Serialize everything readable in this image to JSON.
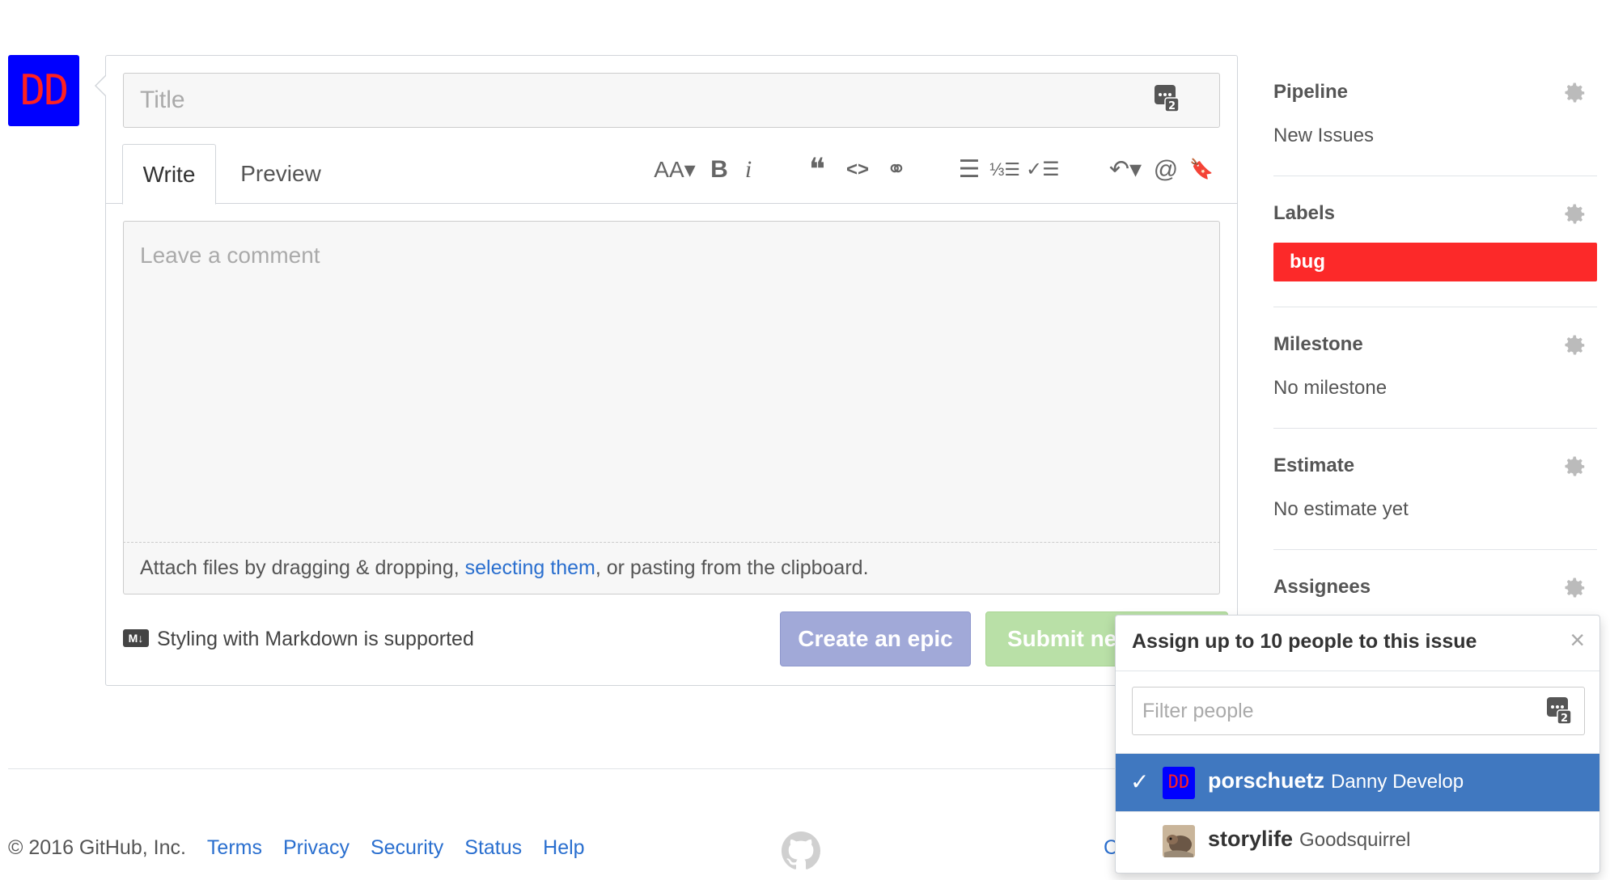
{
  "author_avatar": {
    "initials": "DD",
    "bg": "#0000ff",
    "fg": "#ff2020"
  },
  "editor": {
    "title_placeholder": "Title",
    "tabs": [
      {
        "label": "Write",
        "active": true
      },
      {
        "label": "Preview",
        "active": false
      }
    ],
    "toolbar": {
      "heading": "AA▾",
      "bold": "B",
      "italic": "i",
      "quote": "❝",
      "code": "<>",
      "link": "⚭",
      "bullet_list": "☰",
      "numbered_list": "⅓☰",
      "task_list": "✓☰",
      "reply": "↶▾",
      "mention": "@",
      "reference": "🔖"
    },
    "comment_placeholder": "Leave a comment",
    "attach_before": "Attach files by dragging & dropping, ",
    "attach_link": "selecting them",
    "attach_after": ", or pasting from the clipboard.",
    "markdown_badge": "M↓",
    "markdown_note": "Styling with Markdown is supported",
    "create_epic_label": "Create an epic",
    "submit_label": "Submit new issue"
  },
  "sidebar": {
    "pipeline": {
      "heading": "Pipeline",
      "value": "New Issues"
    },
    "labels": {
      "heading": "Labels",
      "items": [
        {
          "name": "bug",
          "color": "#fc2929"
        }
      ]
    },
    "milestone": {
      "heading": "Milestone",
      "value": "No milestone"
    },
    "estimate": {
      "heading": "Estimate",
      "value": "No estimate yet"
    },
    "assignees": {
      "heading": "Assignees"
    }
  },
  "assign_popover": {
    "title": "Assign up to 10 people to this issue",
    "close": "×",
    "filter_placeholder": "Filter people",
    "people": [
      {
        "login": "porschuetz",
        "name": "Danny Develop",
        "selected": true,
        "check": "✓",
        "avatar_initials": "DD"
      },
      {
        "login": "storylife",
        "name": "Goodsquirrel",
        "selected": false
      }
    ]
  },
  "footer": {
    "copyright": "© 2016 GitHub, Inc.",
    "links": [
      "Terms",
      "Privacy",
      "Security",
      "Status",
      "Help"
    ],
    "partial_right": "C"
  }
}
